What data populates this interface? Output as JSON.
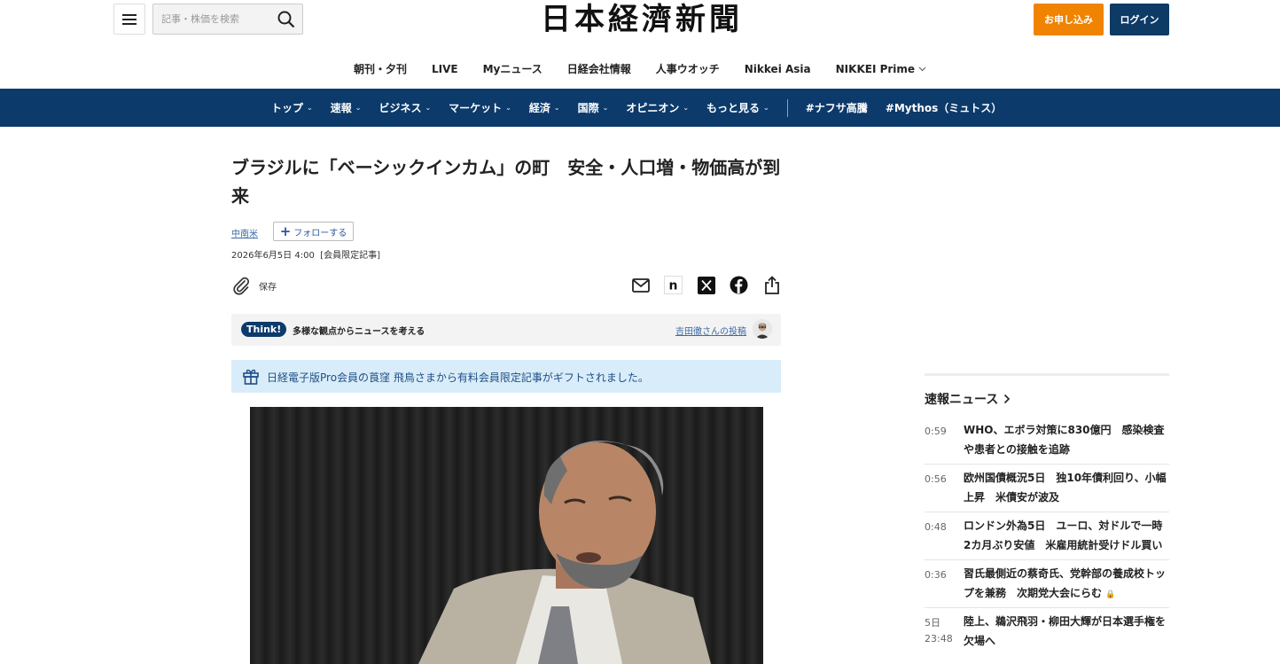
{
  "header": {
    "search_placeholder": "記事・株価を検索",
    "logo": "日本経濟新聞",
    "subscribe_label": "お申し込み",
    "login_label": "ログイン"
  },
  "subnav": [
    "朝刊・夕刊",
    "LIVE",
    "Myニュース",
    "日経会社情報",
    "人事ウオッチ",
    "Nikkei Asia",
    "NIKKEI Prime"
  ],
  "mainnav": {
    "items": [
      "トップ",
      "速報",
      "ビジネス",
      "マーケット",
      "経済",
      "国際",
      "オピニオン",
      "もっと見る"
    ],
    "tags": [
      "#ナフサ高騰",
      "#Mythos（ミュトス）"
    ]
  },
  "article": {
    "title": "ブラジルに「ベーシックインカム」の町　安全・人口増・物価高が到来",
    "topic": "中南米",
    "follow_label": "フォローする",
    "date": "2026年6月5日 4:00",
    "tag": "[会員限定記事]",
    "save_label": "保存",
    "think_badge": "Think!",
    "think_text": "多様な観点からニュースを考える",
    "think_post": "吉田徹さんの投稿",
    "gift_text": "日経電子版Pro会員の莨窪 飛鳥さまから有料会員限定記事がギフトされました。"
  },
  "sidebar": {
    "title": "速報ニュース",
    "items": [
      {
        "time": "0:59",
        "title": "WHO、エボラ対策に830億円　感染検査や患者との接触を追跡",
        "locked": false
      },
      {
        "time": "0:56",
        "title": "欧州国債概況5日　独10年債利回り、小幅上昇　米債安が波及",
        "locked": false
      },
      {
        "time": "0:48",
        "title": "ロンドン外為5日　ユーロ、対ドルで一時2カ月ぶり安値　米雇用統計受けドル買い",
        "locked": false
      },
      {
        "time": "0:36",
        "title": "習氏最側近の蔡奇氏、党幹部の養成校トップを兼務　次期党大会にらむ",
        "locked": true
      },
      {
        "time": "5日\n23:48",
        "title": "陸上、鵜沢飛羽・柳田大輝が日本選手権を欠場へ",
        "locked": false
      }
    ]
  },
  "colors": {
    "navy": "#0c3a6b",
    "orange": "#f08300",
    "gift_bg": "#d9ecf9"
  }
}
